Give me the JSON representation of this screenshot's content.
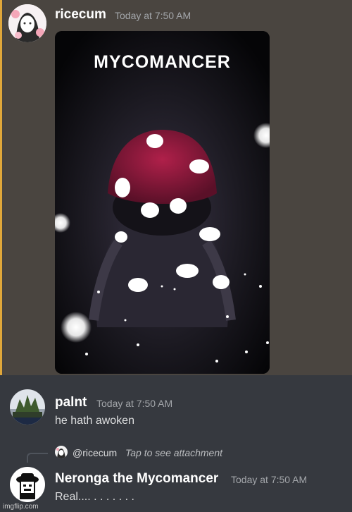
{
  "messages": [
    {
      "username": "ricecum",
      "timestamp": "Today at 7:50 AM",
      "attachment": {
        "title": "MYCOMANCER"
      }
    },
    {
      "username": "palnt",
      "timestamp": "Today at 7:50 AM",
      "text": "he hath awoken"
    },
    {
      "reply": {
        "username": "@ricecum",
        "preview": "Tap to see attachment"
      },
      "username": "Neronga the Mycomancer",
      "timestamp": "Today at 7:50 AM",
      "text": "Real.... . . . . . .  ."
    }
  ],
  "watermark": "imgflip.com",
  "colors": {
    "highlight_bar": "#e0a73a",
    "highlight_bg": "#4a4540",
    "chat_bg": "#36393f"
  }
}
